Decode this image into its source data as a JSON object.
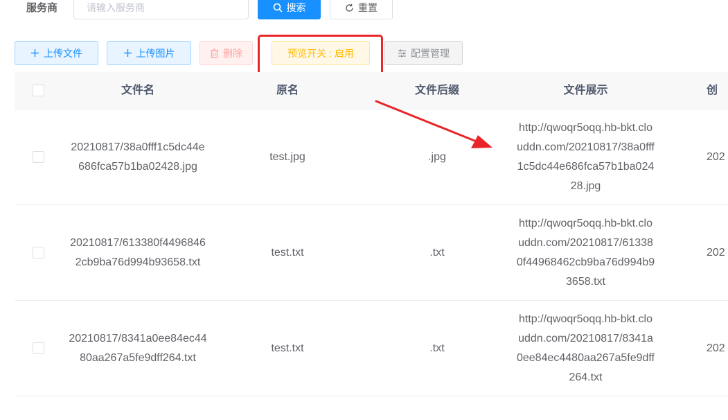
{
  "search": {
    "label": "服务商",
    "placeholder": "请输入服务商",
    "search_button": "搜索",
    "reset_button": "重置"
  },
  "toolbar": {
    "upload_file": "上传文件",
    "upload_image": "上传图片",
    "delete": "删除",
    "preview_switch": "预览开关 : 启用",
    "config_manage": "配置管理"
  },
  "table": {
    "headers": {
      "name": "文件名",
      "original": "原名",
      "suffix": "文件后缀",
      "display": "文件展示",
      "created": "创"
    },
    "rows": [
      {
        "name": "20210817/38a0fff1c5dc44e686fca57b1ba02428.jpg",
        "original": "test.jpg",
        "suffix": ".jpg",
        "display": "http://qwoqr5oqq.hb-bkt.clouddn.com/20210817/38a0fff1c5dc44e686fca57b1ba02428.jpg",
        "created": "202"
      },
      {
        "name": "20210817/613380f44968462cb9ba76d994b93658.txt",
        "original": "test.txt",
        "suffix": ".txt",
        "display": "http://qwoqr5oqq.hb-bkt.clouddn.com/20210817/613380f44968462cb9ba76d994b93658.txt",
        "created": "202"
      },
      {
        "name": "20210817/8341a0ee84ec4480aa267a5fe9dff264.txt",
        "original": "test.txt",
        "suffix": ".txt",
        "display": "http://qwoqr5oqq.hb-bkt.clouddn.com/20210817/8341a0ee84ec4480aa267a5fe9dff264.txt",
        "created": "202"
      }
    ]
  },
  "colors": {
    "primary": "#1890ff",
    "annotation": "#e8262a",
    "warning": "#ffba00",
    "danger_light": "#ffa39e"
  }
}
